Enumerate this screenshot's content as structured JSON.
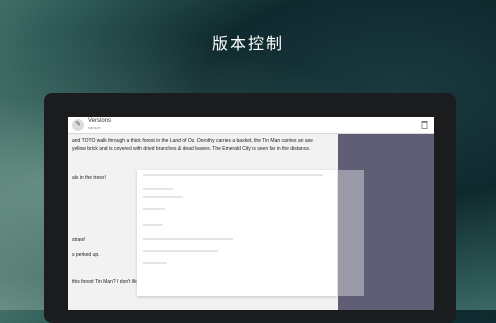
{
  "headline": "版本控制",
  "app": {
    "title": "Versions",
    "subtitle": "sample"
  },
  "document": {
    "lines": [
      "and TOTO walk through a thick forest in the Land of Oz. Dorothy carries a basket, the Tin Man carries an axe",
      "yellow brick and is covered with dried branches & dead leaves. The Emerald City is seen far in the distance.",
      "als in the trees!",
      "straw!",
      "s perked up.",
      "this forest Tin Man? I don't like it here!"
    ]
  },
  "overlay": {
    "rows": [
      "",
      "",
      "",
      "",
      "",
      "",
      ""
    ]
  }
}
